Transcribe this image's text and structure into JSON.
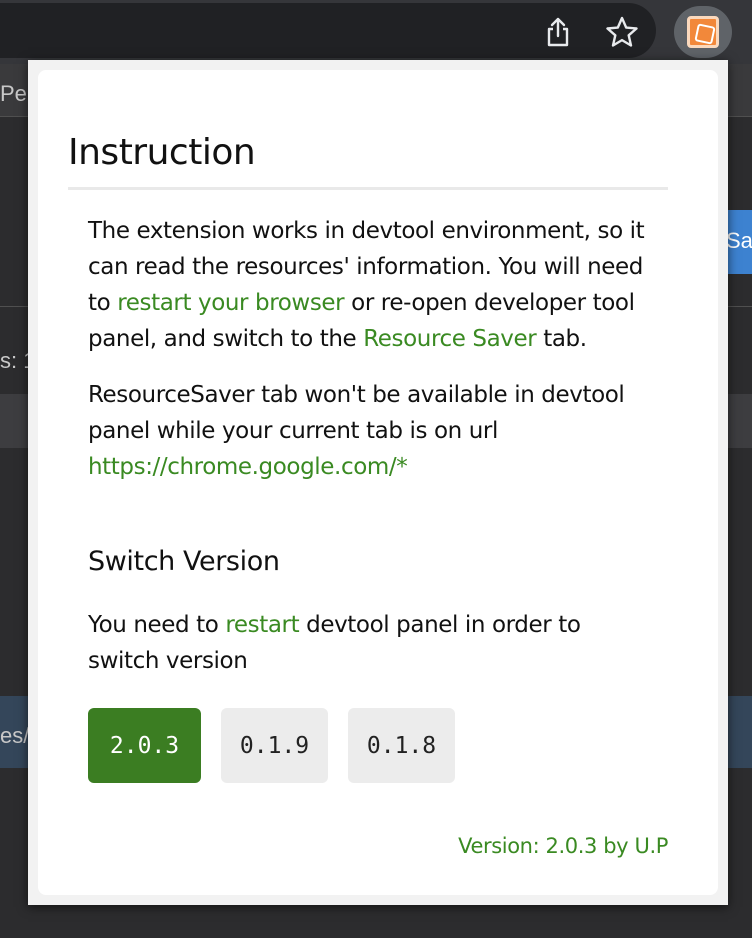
{
  "background": {
    "fragments": [
      "Pe",
      "Sa",
      "s: 1",
      "es/"
    ]
  },
  "popup": {
    "title": "Instruction",
    "paragraph1": {
      "t1": "The extension works in devtool environment, so it can read the resources' information. You will need to ",
      "link1": "restart your browser",
      "t2": " or re-open developer tool panel, and switch to the ",
      "link2": "Resource Saver",
      "t3": " tab."
    },
    "paragraph2": {
      "t1": "ResourceSaver tab won't be available in devtool panel while your current tab is on url ",
      "link": "https://chrome.google.com/*"
    },
    "switch_title": "Switch Version",
    "paragraph3": {
      "t1": "You need to ",
      "link": "restart",
      "t2": " devtool panel in order to switch version"
    },
    "versions": [
      {
        "label": "2.0.3",
        "active": true
      },
      {
        "label": "0.1.9",
        "active": false
      },
      {
        "label": "0.1.8",
        "active": false
      }
    ],
    "footer": "Version: 2.0.3 by U.P"
  },
  "colors": {
    "accent_green": "#3a8a22",
    "active_button": "#3b7d22",
    "extension_logo": "#f2883a"
  },
  "icons": [
    "share-icon",
    "star-icon",
    "resource-saver-extension-icon"
  ]
}
